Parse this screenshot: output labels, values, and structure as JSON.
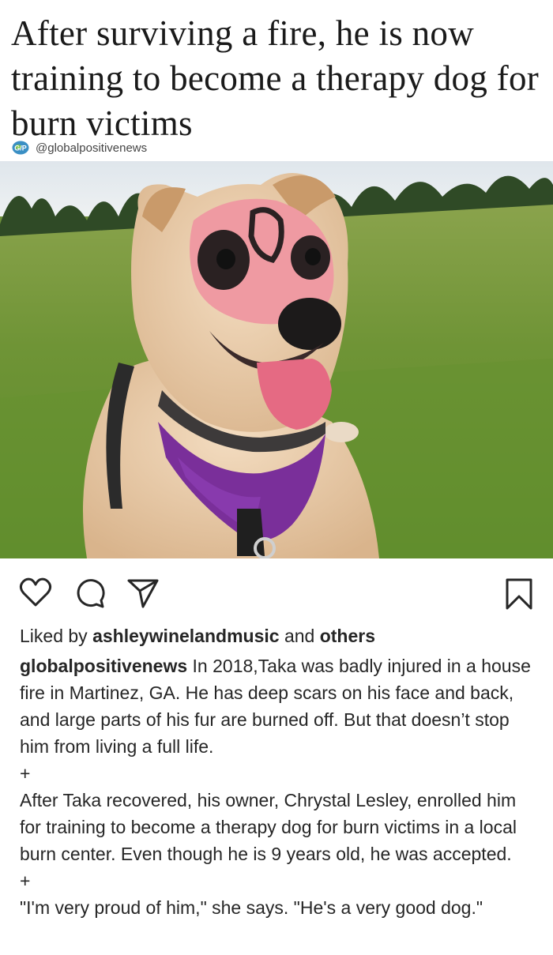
{
  "post": {
    "headline": "After surviving a fire, he is now training to become a therapy dog for burn victims",
    "source_logo_text": "G/P",
    "source_handle": "@globalpositivenews"
  },
  "photo": {
    "description_icon": "dog-photo"
  },
  "actions": {
    "like_icon": "heart-icon",
    "comment_icon": "comment-icon",
    "share_icon": "send-icon",
    "save_icon": "bookmark-icon"
  },
  "likes": {
    "prefix": "Liked by",
    "user": "ashleywinelandmusic",
    "connector": "and",
    "others": "others"
  },
  "caption": {
    "username": "globalpositivenews",
    "paragraph1": "In 2018,Taka was badly injured in a house fire in Martinez, GA. He has deep scars on his face and back, and large parts of his fur are burned off. But that doesn’t stop him from living a full life.",
    "separator1": "+",
    "paragraph2": "After Taka recovered, his owner, Chrystal Lesley, enrolled him for training to become a therapy dog for burn victims in a local burn center. Even though he is 9 years old, he was accepted.",
    "separator2": "+",
    "paragraph3": "\"I'm very proud of him,\" she says. \"He's a very good dog.\""
  }
}
